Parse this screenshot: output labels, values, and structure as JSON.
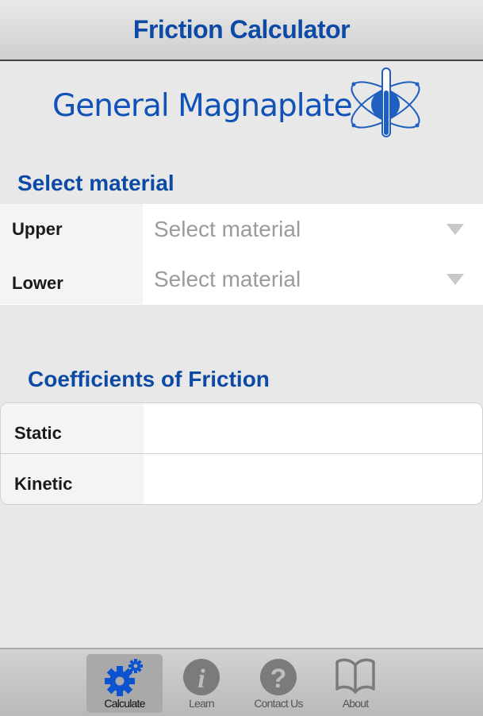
{
  "header": {
    "title": "Friction Calculator"
  },
  "logo": {
    "text": "General Magnaplate",
    "icon": "atom-test-tube-icon"
  },
  "material_section": {
    "title": "Select material",
    "rows": [
      {
        "label": "Upper",
        "placeholder": "Select material"
      },
      {
        "label": "Lower",
        "placeholder": "Select material"
      }
    ]
  },
  "coefficients_section": {
    "title": "Coefficients of Friction",
    "rows": [
      {
        "label": "Static",
        "value": ""
      },
      {
        "label": "Kinetic",
        "value": ""
      }
    ]
  },
  "tabbar": {
    "active": "Calculate",
    "items": [
      {
        "label": "Calculate",
        "icon": "gears-icon"
      },
      {
        "label": "Learn",
        "icon": "info-icon"
      },
      {
        "label": "Contact Us",
        "icon": "question-icon"
      },
      {
        "label": "About",
        "icon": "book-icon"
      }
    ]
  },
  "colors": {
    "accent": "#0d4aa6",
    "logo_blue": "#1152b8",
    "background": "#e8e8e8"
  }
}
